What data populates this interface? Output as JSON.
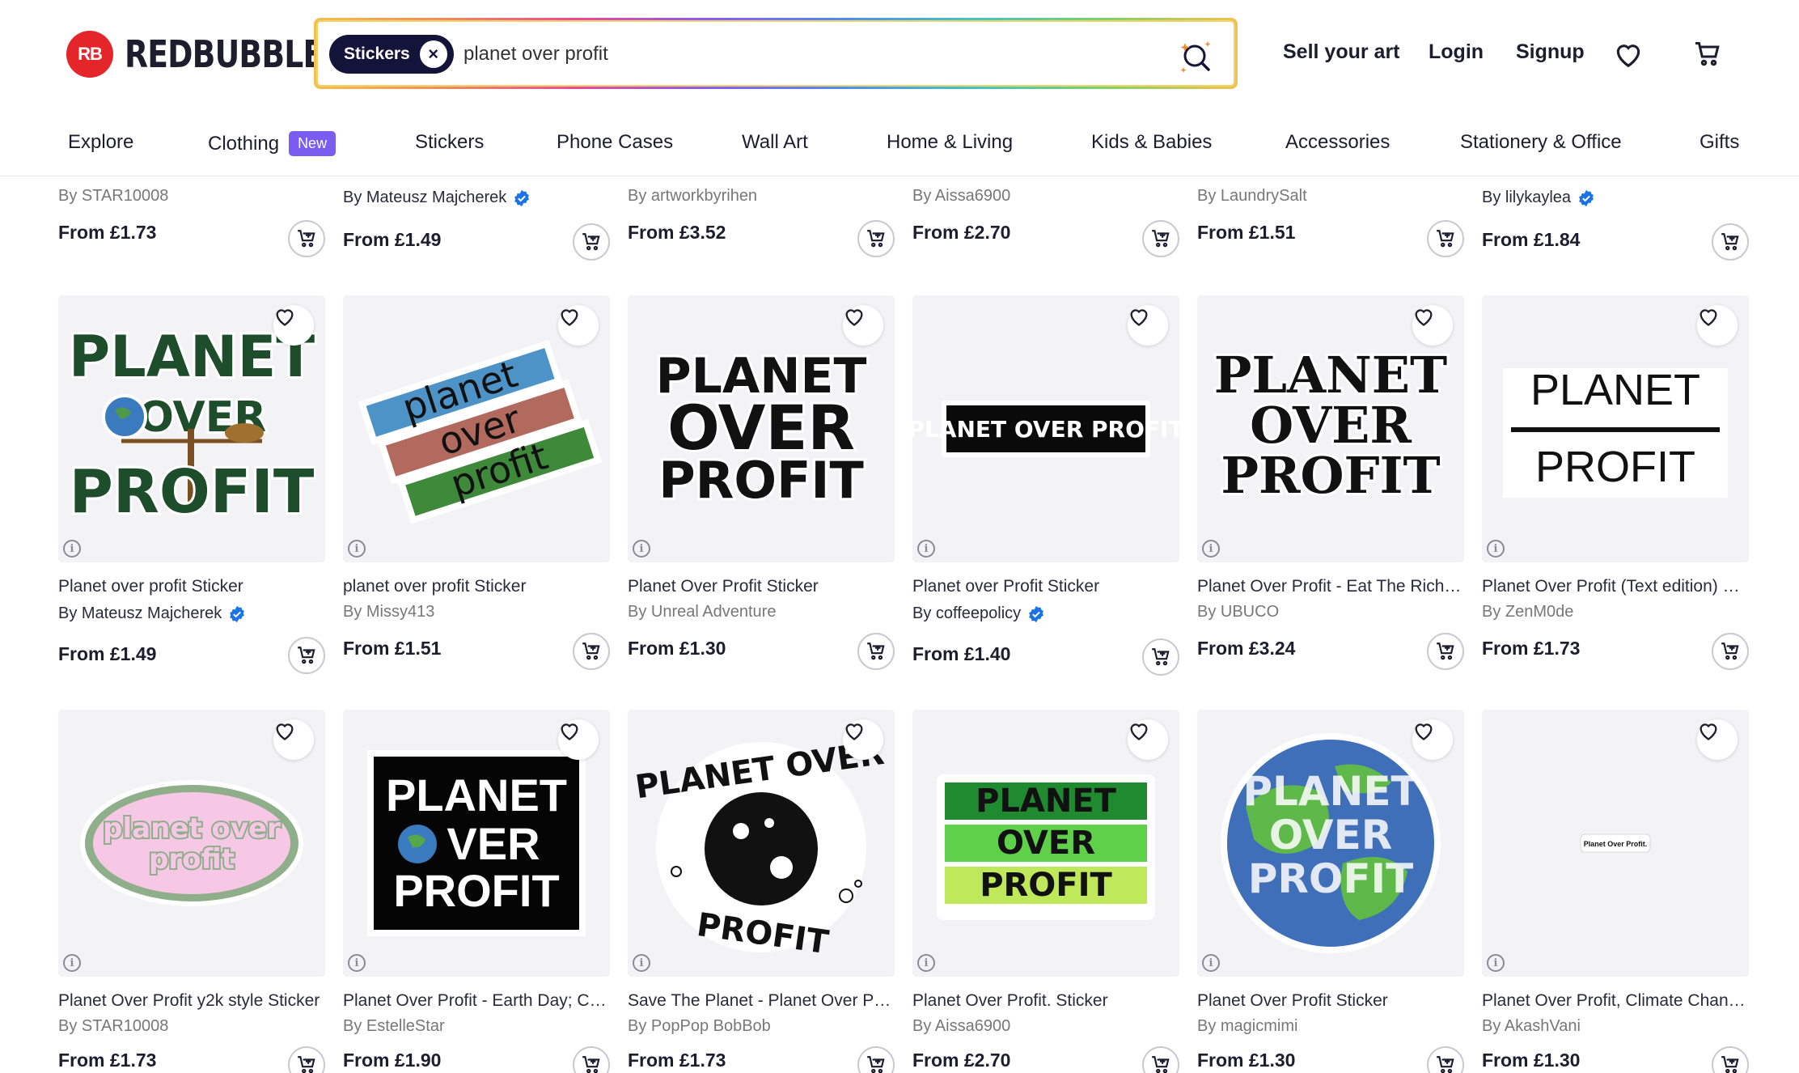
{
  "brand": {
    "mark": "RB",
    "name": "REDBUBBLE"
  },
  "search": {
    "chip": "Stickers",
    "query": "planet over profit"
  },
  "header_links": {
    "sell": "Sell your art",
    "login": "Login",
    "signup": "Signup"
  },
  "nav": [
    {
      "label": "Explore"
    },
    {
      "label": "Clothing",
      "badge": "New"
    },
    {
      "label": "Stickers"
    },
    {
      "label": "Phone Cases"
    },
    {
      "label": "Wall Art"
    },
    {
      "label": "Home & Living"
    },
    {
      "label": "Kids & Babies"
    },
    {
      "label": "Accessories"
    },
    {
      "label": "Stationery & Office"
    },
    {
      "label": "Gifts"
    }
  ],
  "partial_row": [
    {
      "artist": "By STAR10008",
      "verified": false,
      "price": "From £1.73"
    },
    {
      "artist": "By Mateusz Majcherek",
      "verified": true,
      "price": "From £1.49"
    },
    {
      "artist": "By artworkbyrihen",
      "verified": false,
      "price": "From £3.52"
    },
    {
      "artist": "By Aissa6900",
      "verified": false,
      "price": "From £2.70"
    },
    {
      "artist": "By LaundrySalt",
      "verified": false,
      "price": "From £1.51"
    },
    {
      "artist": "By lilykaylea",
      "verified": true,
      "price": "From £1.84"
    }
  ],
  "row2": [
    {
      "title": "Planet over profit Sticker",
      "artist": "By Mateusz Majcherek",
      "verified": true,
      "price": "From £1.49",
      "art": [
        "PLANET",
        "OVER",
        "PROFIT"
      ]
    },
    {
      "title": "planet over profit Sticker",
      "artist": "By Missy413",
      "verified": false,
      "price": "From £1.51",
      "art": [
        "planet",
        "over",
        "profit"
      ]
    },
    {
      "title": "Planet Over Profit Sticker",
      "artist": "By Unreal Adventure",
      "verified": false,
      "price": "From £1.30",
      "art": [
        "PLANET",
        "OVER",
        "PROFIT"
      ]
    },
    {
      "title": "Planet over Profit Sticker",
      "artist": "By coffeepolicy",
      "verified": true,
      "price": "From £1.40",
      "art": [
        "PLANET OVER PROFIT"
      ]
    },
    {
      "title": "Planet Over Profit - Eat The Rich -...",
      "artist": "By UBUCO",
      "verified": false,
      "price": "From £3.24",
      "art": [
        "PLANET",
        "OVER",
        "PROFIT"
      ]
    },
    {
      "title": "Planet Over Profit (Text edition) St...",
      "artist": "By ZenM0de",
      "verified": false,
      "price": "From £1.73",
      "art": [
        "PLANET",
        "PROFIT"
      ]
    }
  ],
  "row3": [
    {
      "title": "Planet Over Profit y2k style Sticker",
      "artist": "By STAR10008",
      "price": "From £1.73",
      "art": [
        "planet over",
        "profit"
      ]
    },
    {
      "title": "Planet Over Profit - Earth Day; Cli...",
      "artist": "By EstelleStar",
      "price": "From £1.90",
      "art": [
        "PLANET",
        "VER",
        "PROFIT"
      ]
    },
    {
      "title": "Save The Planet - Planet Over Pro...",
      "artist": "By PopPop BobBob",
      "price": "From £1.73",
      "art": [
        "PLANET OVER",
        "PROFIT"
      ]
    },
    {
      "title": "Planet Over Profit. Sticker",
      "artist": "By Aissa6900",
      "price": "From £2.70",
      "art": [
        "PLANET",
        "OVER",
        "PROFIT"
      ]
    },
    {
      "title": "Planet Over Profit Sticker",
      "artist": "By magicmimi",
      "price": "From £1.30",
      "art": [
        "PLANET",
        "OVER",
        "PROFIT"
      ]
    },
    {
      "title": "Planet Over Profit, Climate Chang...",
      "artist": "By AkashVani",
      "price": "From £1.30",
      "art": [
        "Planet Over Profit."
      ]
    }
  ]
}
